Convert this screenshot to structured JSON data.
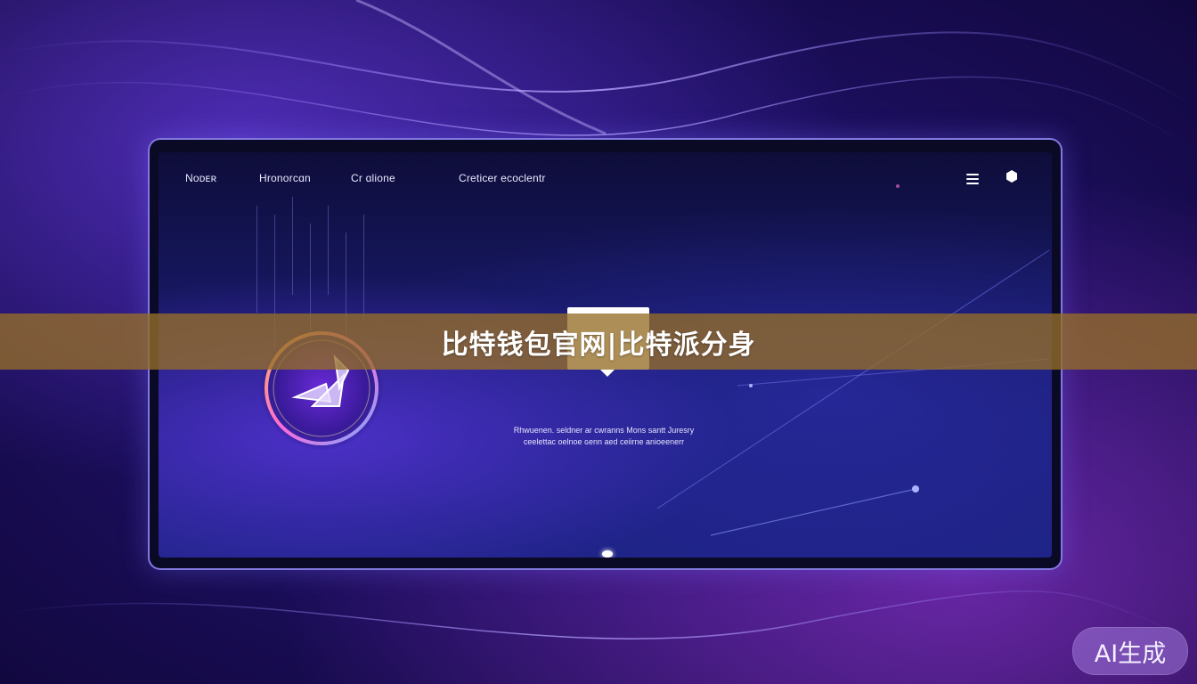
{
  "nav": {
    "item1": "Nᴏᴅᴇʀ",
    "item2": "Hrᴏnᴏrᴄɑn",
    "item3": "Cr ɑlione",
    "item4": "Creticer ecoclentr"
  },
  "copy": {
    "line1": "Rhwuenen. seldner ar cwranns Mons santt Juresry",
    "line2": "ceelettac oelnoe ɢenn aed ceiirne  anioeenerr"
  },
  "banner": {
    "title": "比特钱包官网|比特派分身"
  },
  "badge": {
    "label": "AI生成"
  },
  "colors": {
    "banner_bg": "#96702a",
    "frame_border": "#968cff",
    "screen_top": "#0e0d3a",
    "screen_bottom": "#1e2386"
  },
  "icons": {
    "menu": "hamburger-menu-icon",
    "profile": "hexagon-profile-icon"
  }
}
